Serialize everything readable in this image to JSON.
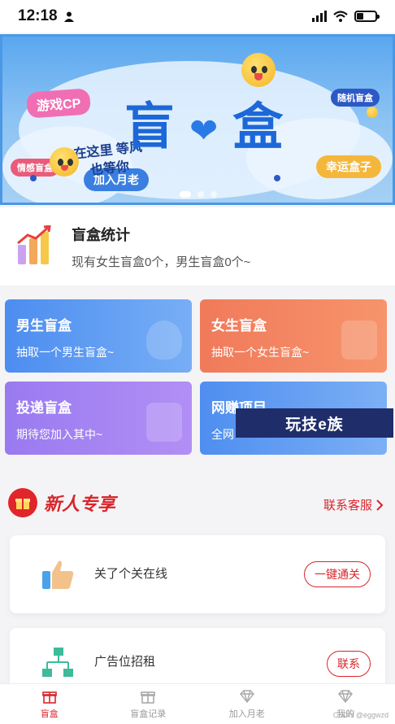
{
  "status_bar": {
    "time": "12:18"
  },
  "banner": {
    "title_left": "盲",
    "title_heart": "❤",
    "title_right": "盒",
    "tag_cp": "游戏CP",
    "tag_random": "随机盲盒",
    "tag_feel": "情感盲盒",
    "tag_join": "加入月老",
    "tag_lucky": "幸运盒子",
    "hand_text": "在这里 等风 也等你"
  },
  "info": {
    "title": "盲盒统计",
    "subtitle": "现有女生盲盒0个，男生盲盒0个~"
  },
  "cards": [
    {
      "title": "男生盲盒",
      "subtitle": "抽取一个男生盲盒~"
    },
    {
      "title": "女生盲盒",
      "subtitle": "抽取一个女生盲盒~"
    },
    {
      "title": "投递盲盒",
      "subtitle": "期待您加入其中~"
    },
    {
      "title": "网赚项目",
      "subtitle": "全网"
    }
  ],
  "watermark": "玩技e族",
  "new_user": {
    "title": "新人专享",
    "contact": "联系客服"
  },
  "list": [
    {
      "text": "关了个关在线",
      "button": "一键通关"
    },
    {
      "text": "广告位招租",
      "button": "联系"
    }
  ],
  "tabbar": [
    {
      "label": "盲盒",
      "active": true
    },
    {
      "label": "盲盒记录",
      "active": false
    },
    {
      "label": "加入月老",
      "active": false
    },
    {
      "label": "我的",
      "active": false
    }
  ],
  "csdn_mark": "CSDN @eggwzd",
  "colors": {
    "accent": "#d8262b",
    "male": "#4c8df0",
    "female": "#f07a5a",
    "deliver": "#9a7af0"
  }
}
